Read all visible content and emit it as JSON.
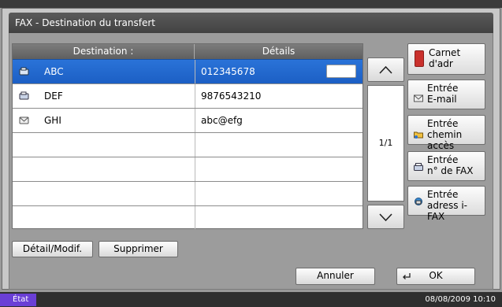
{
  "window": {
    "title": "FAX - Destination du transfert"
  },
  "table": {
    "headers": {
      "destination": "Destination :",
      "details": "Détails"
    },
    "rows": [
      {
        "name": "ABC",
        "detail": "012345678",
        "icon": "fax-icon",
        "selected": true
      },
      {
        "name": "DEF",
        "detail": "9876543210",
        "icon": "fax-icon",
        "selected": false
      },
      {
        "name": "GHI",
        "detail": "abc@efg",
        "icon": "email-icon",
        "selected": false
      },
      {
        "name": "",
        "detail": ""
      },
      {
        "name": "",
        "detail": ""
      },
      {
        "name": "",
        "detail": ""
      },
      {
        "name": "",
        "detail": ""
      }
    ]
  },
  "scroll": {
    "page": "1/1"
  },
  "right_buttons": {
    "address_book": "Carnet d'adr",
    "email": [
      "Entrée",
      "E-mail"
    ],
    "path": [
      "Entrée",
      "chemin accès"
    ],
    "fax_no": [
      "Entrée",
      "n° de FAX"
    ],
    "ifax": [
      "Entrée",
      "adress i-FAX"
    ]
  },
  "bottom": {
    "detail": "Détail/Modif.",
    "delete": "Supprimer"
  },
  "footer": {
    "cancel": "Annuler",
    "ok": "OK"
  },
  "status": {
    "label": "État",
    "datetime": "08/08/2009    10:10"
  },
  "colors": {
    "selected_row": "#1f66cc",
    "status_label": "#6a3fd6",
    "title_bar": "#4c4c4c"
  }
}
